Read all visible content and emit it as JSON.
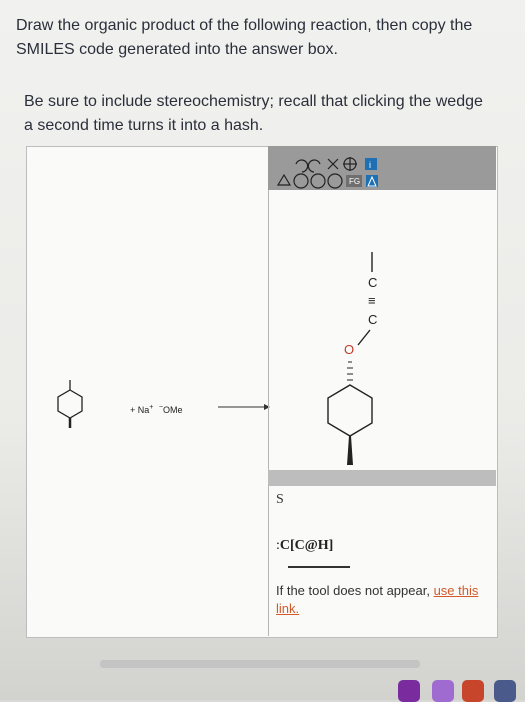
{
  "question": {
    "line1": "Draw the organic product of the following reaction, then copy the",
    "line2": "SMILES code generated into the answer box."
  },
  "note": {
    "line1": "Be sure to include stereochemistry; recall that clicking the wedge",
    "line2": "a second time turns it into a hash."
  },
  "reaction": {
    "reagent_main": "+ Na",
    "reagent_sup": "+",
    "reagent_sup2": "−",
    "reagent_tail": "OMe"
  },
  "editor": {
    "toolbar": {
      "icons": [
        "undo-icon",
        "redo-icon",
        "erase-icon",
        "zoom-icon",
        "info-icon",
        "cyclopropane-icon",
        "cyclohexane-icon",
        "cyclopentane-icon",
        "benzene-icon",
        "fg-icon",
        "triangle-icon"
      ],
      "fg_label": "FG"
    },
    "atoms": {
      "O": "O",
      "C1": "C",
      "C2": "C",
      "triple": "≡"
    },
    "label_s": "S",
    "smiles_partial": "C[C@H]"
  },
  "help": {
    "text": "If the tool does not appear, ",
    "link": "use this link."
  },
  "colors": {
    "text": "#2b2f3a",
    "toolbar": "#9a9a9a",
    "link": "#d35a2a"
  }
}
